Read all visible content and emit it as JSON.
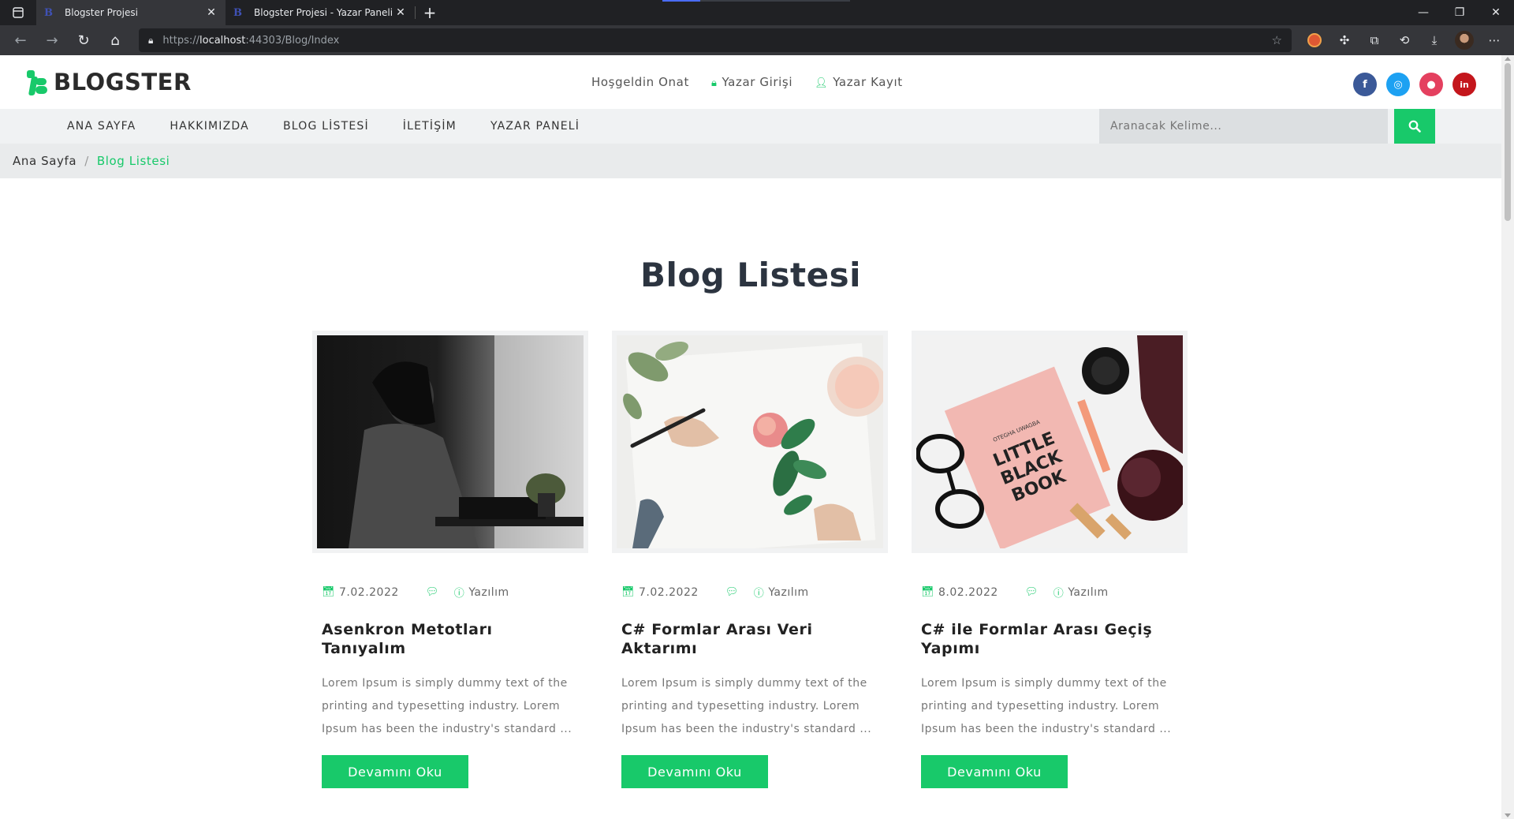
{
  "browser": {
    "tabs": [
      {
        "title": "Blogster Projesi",
        "favicon": "B",
        "active": true
      },
      {
        "title": "Blogster Projesi - Yazar Paneli",
        "favicon": "B",
        "active": false
      }
    ],
    "url_scheme": "https://",
    "url_host": "localhost",
    "url_rest": ":44303/Blog/Index"
  },
  "site": {
    "logo_text": "BLOGSTER",
    "welcome": "Hoşgeldin Onat",
    "login": "Yazar Girişi",
    "register": "Yazar Kayıt",
    "socials": [
      {
        "name": "facebook",
        "glyph": "f",
        "color": "#3b5998"
      },
      {
        "name": "instagram",
        "glyph": "◎",
        "color": "#1da1f2"
      },
      {
        "name": "github",
        "glyph": "●",
        "color": "#e4405f"
      },
      {
        "name": "linkedin",
        "glyph": "in",
        "color": "#c4161c"
      }
    ],
    "accent": "#18c96a"
  },
  "menu": {
    "items": [
      "ANA SAYFA",
      "HAKKIMIZDA",
      "BLOG LİSTESİ",
      "İLETİŞİM",
      "YAZAR PANELİ"
    ],
    "search_placeholder": "Aranacak Kelime..."
  },
  "breadcrumb": {
    "home": "Ana Sayfa",
    "sep": "/",
    "current": "Blog Listesi"
  },
  "page": {
    "title": "Blog Listesi"
  },
  "posts": [
    {
      "date": "7.02.2022",
      "category": "Yazılım",
      "title": "Asenkron Metotları Tanıyalım",
      "excerpt": "Lorem Ipsum is simply dummy text of the printing and typesetting industry. Lorem Ipsum has been the industry's standard ...",
      "button": "Devamını Oku"
    },
    {
      "date": "7.02.2022",
      "category": "Yazılım",
      "title": "C# Formlar Arası Veri Aktarımı",
      "excerpt": "Lorem Ipsum is simply dummy text of the printing and typesetting industry. Lorem Ipsum has been the industry's standard ...",
      "button": "Devamını Oku"
    },
    {
      "date": "8.02.2022",
      "category": "Yazılım",
      "title": "C# ile Formlar Arası Geçiş Yapımı",
      "excerpt": "Lorem Ipsum is simply dummy text of the printing and typesetting industry. Lorem Ipsum has been the industry's standard ...",
      "button": "Devamını Oku"
    }
  ]
}
